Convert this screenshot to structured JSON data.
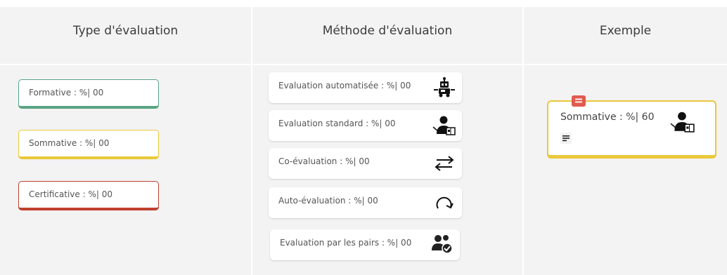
{
  "columns": {
    "type": {
      "title": "Type d'évaluation"
    },
    "method": {
      "title": "Méthode d'évaluation"
    },
    "example": {
      "title": "Exemple"
    }
  },
  "types": [
    {
      "label": "Formative :   %| 00",
      "color": "#5aa484"
    },
    {
      "label": "Sommative :   %| 00",
      "color": "#eac83a"
    },
    {
      "label": "Certificative :   %| 00",
      "color": "#c0402f"
    }
  ],
  "methods": [
    {
      "label": "Evaluation automatisée :   %| 00",
      "icon": "robot-icon"
    },
    {
      "label": "Evaluation standard :   %| 00",
      "icon": "teacher-icon"
    },
    {
      "label": "Co-évaluation :   %| 00",
      "icon": "swap-arrows-icon"
    },
    {
      "label": "Auto-évaluation :   %| 00",
      "icon": "redo-arrow-icon"
    },
    {
      "label": "Evaluation par les pairs :   %| 00",
      "icon": "peer-check-icon"
    }
  ],
  "example": {
    "label": "Sommative :   %| 60",
    "icon": "teacher-icon",
    "badge_icon": "comment-icon",
    "note_icon": "notes-icon",
    "color": "#eac83a"
  }
}
